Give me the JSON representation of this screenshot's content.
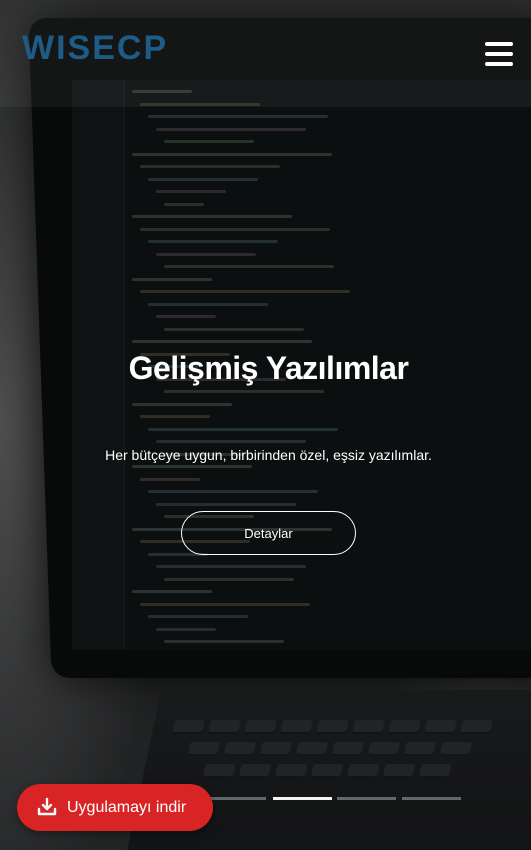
{
  "header": {
    "logo_text": "WISECP",
    "menu_icon": "hamburger-menu-icon",
    "logo_color": "#1c5c86"
  },
  "hero": {
    "title": "Gelişmiş Yazılımlar",
    "subtitle": "Her bütçeye uygun, birbirinden özel, eşsiz yazılımlar.",
    "button_label": "Detaylar"
  },
  "slider": {
    "slide_count": 5,
    "active_index": 2
  },
  "download": {
    "label": "Uygulamayı indir",
    "icon": "download-icon",
    "color": "#d82424"
  }
}
